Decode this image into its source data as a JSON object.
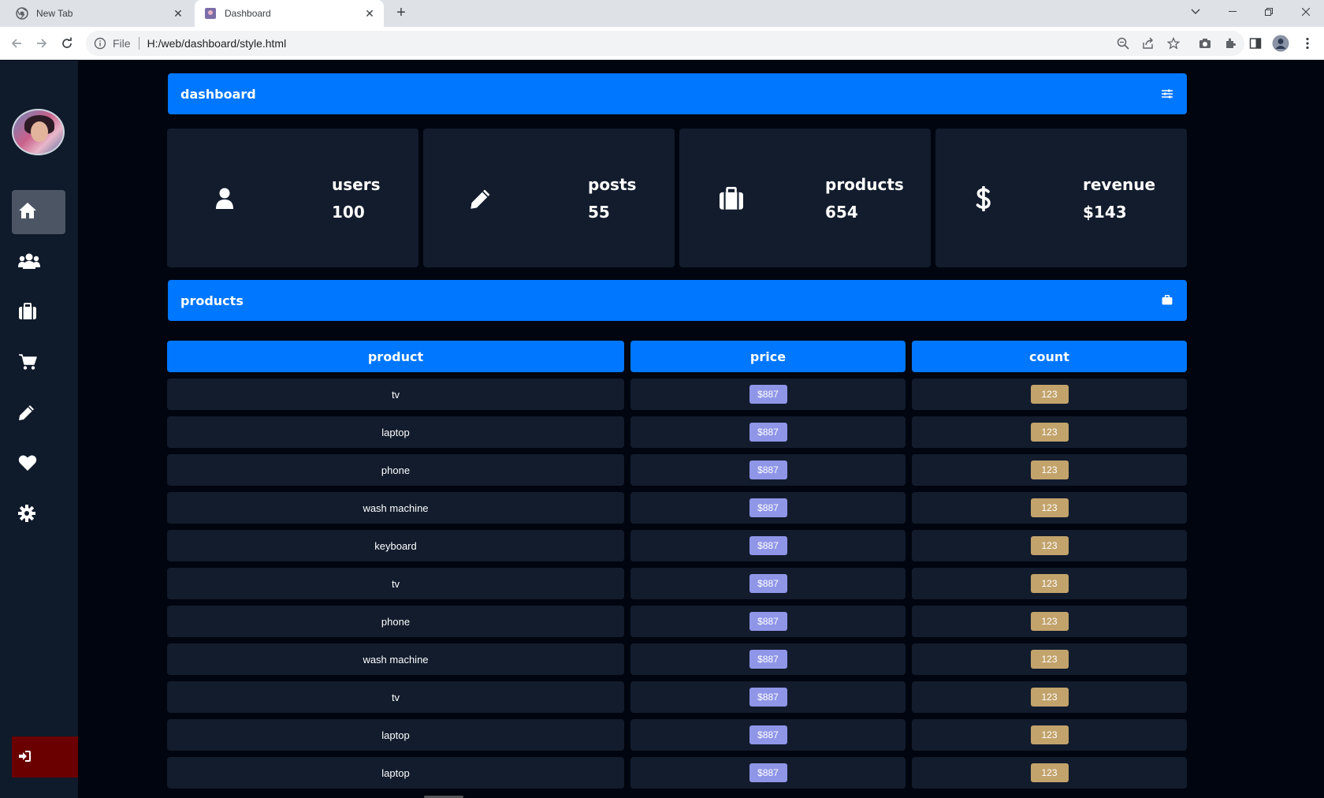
{
  "browser": {
    "tabs": [
      {
        "title": "New Tab",
        "active": false
      },
      {
        "title": "Dashboard",
        "active": true
      }
    ],
    "address": {
      "scheme_label": "File",
      "url": "H:/web/dashboard/style.html"
    }
  },
  "sidebar": {
    "items": [
      {
        "icon": "home-icon",
        "active": true
      },
      {
        "icon": "users-icon",
        "active": false
      },
      {
        "icon": "briefcase-icon",
        "active": false
      },
      {
        "icon": "cart-icon",
        "active": false
      },
      {
        "icon": "pencil-icon",
        "active": false
      },
      {
        "icon": "heart-icon",
        "active": false
      },
      {
        "icon": "gear-icon",
        "active": false
      }
    ],
    "logout_icon": "sign-in-icon"
  },
  "header": {
    "title": "dashboard",
    "icon": "sliders-icon"
  },
  "stats": [
    {
      "label": "users",
      "value": "100",
      "icon": "user-icon"
    },
    {
      "label": "posts",
      "value": "55",
      "icon": "pencil-icon"
    },
    {
      "label": "products",
      "value": "654",
      "icon": "briefcase-icon"
    },
    {
      "label": "revenue",
      "value": "$143",
      "icon": "dollar-icon"
    }
  ],
  "products_section": {
    "title": "products",
    "icon": "briefcase-icon"
  },
  "table": {
    "columns": [
      "product",
      "price",
      "count"
    ],
    "rows": [
      {
        "product": "tv",
        "price": "$887",
        "count": "123"
      },
      {
        "product": "laptop",
        "price": "$887",
        "count": "123"
      },
      {
        "product": "phone",
        "price": "$887",
        "count": "123"
      },
      {
        "product": "wash machine",
        "price": "$887",
        "count": "123"
      },
      {
        "product": "keyboard",
        "price": "$887",
        "count": "123"
      },
      {
        "product": "tv",
        "price": "$887",
        "count": "123"
      },
      {
        "product": "phone",
        "price": "$887",
        "count": "123"
      },
      {
        "product": "wash machine",
        "price": "$887",
        "count": "123"
      },
      {
        "product": "tv",
        "price": "$887",
        "count": "123"
      },
      {
        "product": "laptop",
        "price": "$887",
        "count": "123"
      },
      {
        "product": "laptop",
        "price": "$887",
        "count": "123"
      }
    ]
  },
  "colors": {
    "accent": "#0077ff",
    "card": "#121c2d",
    "background": "#01050f",
    "price_badge": "#8f96e8",
    "count_badge": "#c2a36c",
    "logout": "#6b0000"
  }
}
